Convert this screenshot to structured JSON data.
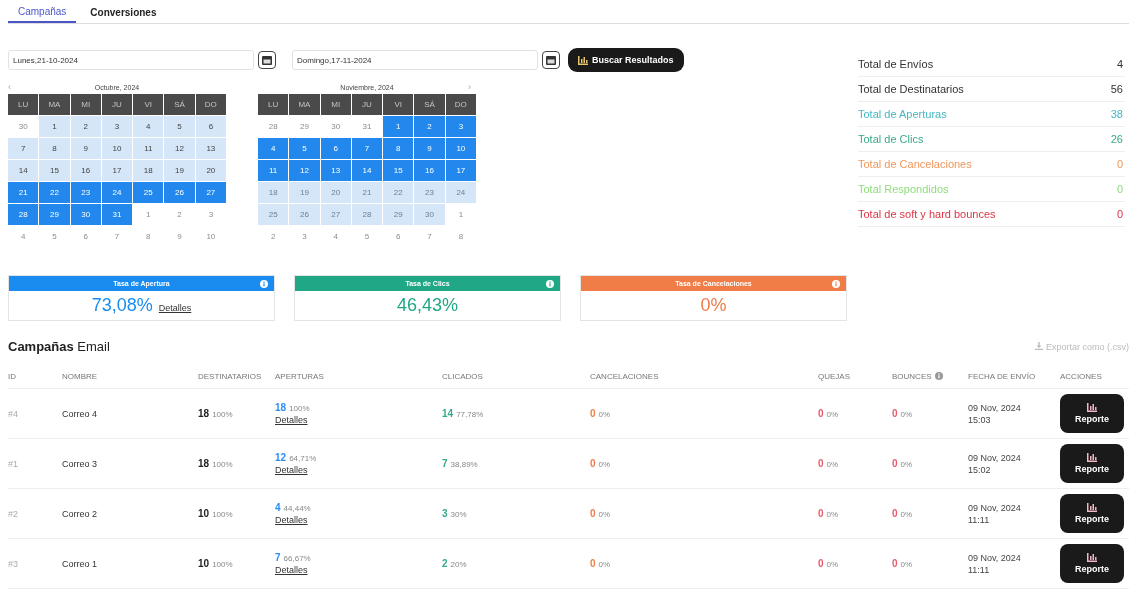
{
  "tabs": [
    {
      "label": "Campañas",
      "selected": true
    },
    {
      "label": "Conversiones",
      "selected": false
    }
  ],
  "date_from": {
    "value": "Lunes,21-10-2024"
  },
  "date_to": {
    "value": "Domingo,17-11-2024"
  },
  "search_button": "Buscar Resultados",
  "calendars": [
    {
      "title": "Octubre, 2024",
      "prev": "‹",
      "weekdays": [
        "LU",
        "MA",
        "MI",
        "JU",
        "VI",
        "SÁ",
        "DO"
      ],
      "weeks": [
        [
          {
            "label": "30",
            "kind": "muted"
          },
          {
            "label": "1",
            "kind": "range"
          },
          {
            "label": "2",
            "kind": "range"
          },
          {
            "label": "3",
            "kind": "range"
          },
          {
            "label": "4",
            "kind": "range"
          },
          {
            "label": "5",
            "kind": "range"
          },
          {
            "label": "6",
            "kind": "range"
          }
        ],
        [
          {
            "label": "7",
            "kind": "range"
          },
          {
            "label": "8",
            "kind": "range"
          },
          {
            "label": "9",
            "kind": "range"
          },
          {
            "label": "10",
            "kind": "range"
          },
          {
            "label": "11",
            "kind": "range"
          },
          {
            "label": "12",
            "kind": "range"
          },
          {
            "label": "13",
            "kind": "range"
          }
        ],
        [
          {
            "label": "14",
            "kind": "range"
          },
          {
            "label": "15",
            "kind": "range"
          },
          {
            "label": "16",
            "kind": "range"
          },
          {
            "label": "17",
            "kind": "range"
          },
          {
            "label": "18",
            "kind": "range"
          },
          {
            "label": "19",
            "kind": "range"
          },
          {
            "label": "20",
            "kind": "range"
          }
        ],
        [
          {
            "label": "21",
            "kind": "selected"
          },
          {
            "label": "22",
            "kind": "selected"
          },
          {
            "label": "23",
            "kind": "selected"
          },
          {
            "label": "24",
            "kind": "selected"
          },
          {
            "label": "25",
            "kind": "selected"
          },
          {
            "label": "26",
            "kind": "selected"
          },
          {
            "label": "27",
            "kind": "selected"
          }
        ],
        [
          {
            "label": "28",
            "kind": "selected"
          },
          {
            "label": "29",
            "kind": "selected"
          },
          {
            "label": "30",
            "kind": "selected"
          },
          {
            "label": "31",
            "kind": "selected"
          },
          {
            "label": "1",
            "kind": "muted"
          },
          {
            "label": "2",
            "kind": "muted"
          },
          {
            "label": "3",
            "kind": "muted"
          }
        ],
        [
          {
            "label": "4",
            "kind": "muted"
          },
          {
            "label": "5",
            "kind": "muted"
          },
          {
            "label": "6",
            "kind": "muted"
          },
          {
            "label": "7",
            "kind": "muted"
          },
          {
            "label": "8",
            "kind": "muted"
          },
          {
            "label": "9",
            "kind": "muted"
          },
          {
            "label": "10",
            "kind": "muted"
          }
        ]
      ]
    },
    {
      "title": "Noviembre, 2024",
      "next": "›",
      "weekdays": [
        "LU",
        "MA",
        "MI",
        "JU",
        "VI",
        "SÁ",
        "DO"
      ],
      "weeks": [
        [
          {
            "label": "28",
            "kind": "muted"
          },
          {
            "label": "29",
            "kind": "muted"
          },
          {
            "label": "30",
            "kind": "muted"
          },
          {
            "label": "31",
            "kind": "muted"
          },
          {
            "label": "1",
            "kind": "selected"
          },
          {
            "label": "2",
            "kind": "selected"
          },
          {
            "label": "3",
            "kind": "selected"
          }
        ],
        [
          {
            "label": "4",
            "kind": "selected"
          },
          {
            "label": "5",
            "kind": "selected"
          },
          {
            "label": "6",
            "kind": "selected"
          },
          {
            "label": "7",
            "kind": "selected"
          },
          {
            "label": "8",
            "kind": "selected"
          },
          {
            "label": "9",
            "kind": "selected"
          },
          {
            "label": "10",
            "kind": "selected"
          }
        ],
        [
          {
            "label": "11",
            "kind": "selected"
          },
          {
            "label": "12",
            "kind": "selected"
          },
          {
            "label": "13",
            "kind": "selected"
          },
          {
            "label": "14",
            "kind": "selected"
          },
          {
            "label": "15",
            "kind": "selected"
          },
          {
            "label": "16",
            "kind": "selected"
          },
          {
            "label": "17",
            "kind": "selected"
          }
        ],
        [
          {
            "label": "18",
            "kind": "range-muted"
          },
          {
            "label": "19",
            "kind": "range-muted"
          },
          {
            "label": "20",
            "kind": "range-muted"
          },
          {
            "label": "21",
            "kind": "range-muted"
          },
          {
            "label": "22",
            "kind": "range-muted"
          },
          {
            "label": "23",
            "kind": "range-muted"
          },
          {
            "label": "24",
            "kind": "range-muted"
          }
        ],
        [
          {
            "label": "25",
            "kind": "range-muted"
          },
          {
            "label": "26",
            "kind": "range-muted"
          },
          {
            "label": "27",
            "kind": "range-muted"
          },
          {
            "label": "28",
            "kind": "range-muted"
          },
          {
            "label": "29",
            "kind": "range-muted"
          },
          {
            "label": "30",
            "kind": "range-muted"
          },
          {
            "label": "1",
            "kind": "muted"
          }
        ],
        [
          {
            "label": "2",
            "kind": "muted"
          },
          {
            "label": "3",
            "kind": "muted"
          },
          {
            "label": "4",
            "kind": "muted"
          },
          {
            "label": "5",
            "kind": "muted"
          },
          {
            "label": "6",
            "kind": "muted"
          },
          {
            "label": "7",
            "kind": "muted"
          },
          {
            "label": "8",
            "kind": "muted"
          }
        ]
      ]
    }
  ],
  "totals": [
    {
      "label": "Total de Envíos",
      "value": "4",
      "color": "#333333"
    },
    {
      "label": "Total de Destinatarios",
      "value": "56",
      "color": "#333333"
    },
    {
      "label": "Total de Aperturas",
      "value": "38",
      "color": "#45b8c4"
    },
    {
      "label": "Total de Clics",
      "value": "26",
      "color": "#3aa88a"
    },
    {
      "label": "Total de Cancelaciones",
      "value": "0",
      "color": "#f0965a"
    },
    {
      "label": "Total Respondidos",
      "value": "0",
      "color": "#8fdc7a"
    },
    {
      "label": "Total de soft y hard bounces",
      "value": "0",
      "color": "#dc3545"
    }
  ],
  "rate_cards": [
    {
      "title": "Tasa de Apertura",
      "value": "73,08%",
      "link": "Detalles",
      "color": "#1a8cf0"
    },
    {
      "title": "Tasa de Clics",
      "value": "46,43%",
      "color": "#20a886"
    },
    {
      "title": "Tasa de Cancelaciones",
      "value": "0%",
      "color": "#f07c48"
    }
  ],
  "campaigns": {
    "title": "**Campañas** Email",
    "export_link": "Exportar como (.csv)",
    "columns": [
      {
        "label": "ID"
      },
      {
        "label": "NOMBRE"
      },
      {
        "label": "DESTINATARIOS"
      },
      {
        "label": "APERTURAS"
      },
      {
        "label": "CLICADOS"
      },
      {
        "label": "CANCELACIONES"
      },
      {
        "label": "QUEJAS"
      },
      {
        "label": "BOUNCES",
        "info": true
      },
      {
        "label": "FECHA DE ENVÍO"
      },
      {
        "label": "ACCIONES"
      }
    ],
    "rows": [
      {
        "id": "#4",
        "name": "Correo 4",
        "recipients": {
          "value": "18",
          "pct": "100%"
        },
        "opens": {
          "value": "18",
          "pct": "100%",
          "link": "Detalles"
        },
        "clicks": {
          "value": "14",
          "pct": "77,78%"
        },
        "cancels": {
          "value": "0",
          "pct": "0%"
        },
        "complaints": {
          "value": "0",
          "pct": "0%"
        },
        "bounces": {
          "value": "0",
          "pct": "0%"
        },
        "date": "09 Nov, 2024",
        "time": "15:03",
        "action": "Reporte"
      },
      {
        "id": "#1",
        "name": "Correo 3",
        "recipients": {
          "value": "18",
          "pct": "100%"
        },
        "opens": {
          "value": "12",
          "pct": "64,71%",
          "link": "Detalles"
        },
        "clicks": {
          "value": "7",
          "pct": "38,89%"
        },
        "cancels": {
          "value": "0",
          "pct": "0%"
        },
        "complaints": {
          "value": "0",
          "pct": "0%"
        },
        "bounces": {
          "value": "0",
          "pct": "0%"
        },
        "date": "09 Nov, 2024",
        "time": "15:02",
        "action": "Reporte"
      },
      {
        "id": "#2",
        "name": "Correo 2",
        "recipients": {
          "value": "10",
          "pct": "100%"
        },
        "opens": {
          "value": "4",
          "pct": "44,44%",
          "link": "Detalles"
        },
        "clicks": {
          "value": "3",
          "pct": "30%"
        },
        "cancels": {
          "value": "0",
          "pct": "0%"
        },
        "complaints": {
          "value": "0",
          "pct": "0%"
        },
        "bounces": {
          "value": "0",
          "pct": "0%"
        },
        "date": "09 Nov, 2024",
        "time": "11:11",
        "action": "Reporte"
      },
      {
        "id": "#3",
        "name": "Correo 1",
        "recipients": {
          "value": "10",
          "pct": "100%"
        },
        "opens": {
          "value": "7",
          "pct": "66,67%",
          "link": "Detalles"
        },
        "clicks": {
          "value": "2",
          "pct": "20%"
        },
        "cancels": {
          "value": "0",
          "pct": "0%"
        },
        "complaints": {
          "value": "0",
          "pct": "0%"
        },
        "bounces": {
          "value": "0",
          "pct": "0%"
        },
        "date": "09 Nov, 2024",
        "time": "11:11",
        "action": "Reporte"
      }
    ]
  }
}
